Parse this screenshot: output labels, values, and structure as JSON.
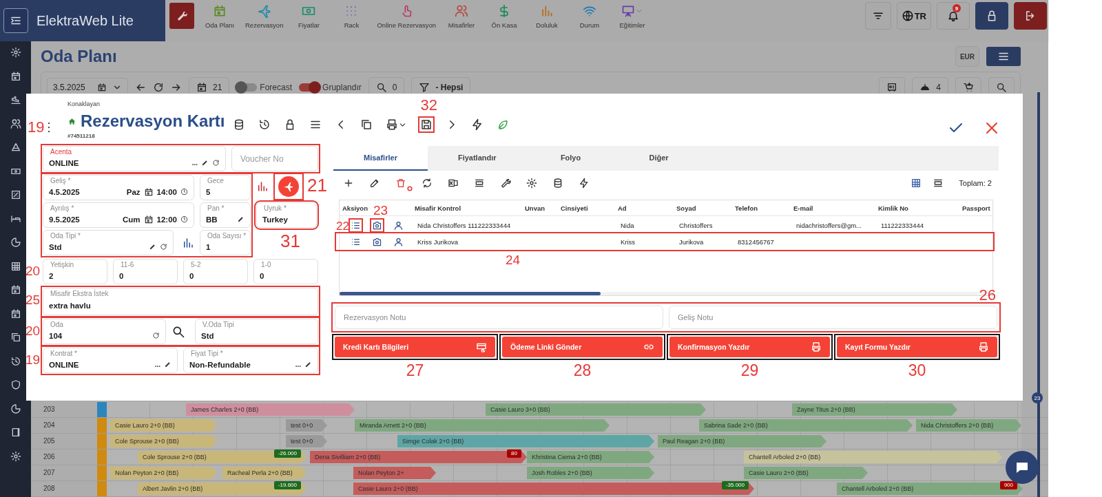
{
  "app": {
    "brand": "ElektraWeb Lite"
  },
  "nav": [
    {
      "label": "Oda Planı"
    },
    {
      "label": "Rezervasyon"
    },
    {
      "label": "Fiyatlar"
    },
    {
      "label": "Rack"
    },
    {
      "label": "Online Rezervasyon"
    },
    {
      "label": "Misafirler"
    },
    {
      "label": "Ön Kasa"
    },
    {
      "label": "Doluluk"
    },
    {
      "label": "Durum"
    },
    {
      "label": "Eğitimler"
    }
  ],
  "topbar_right": {
    "language": "TR",
    "notifications": "9"
  },
  "page": {
    "title": "Oda Planı",
    "currency": "EUR"
  },
  "toolbar": {
    "date": "3.5.2025",
    "days": "21",
    "forecast": {
      "label": "Forecast",
      "on": false
    },
    "grouping": {
      "label": "Gruplandır",
      "on": true
    },
    "search_count": "0",
    "filter": "- Hepsi",
    "room_service_count": "4"
  },
  "room_grid": {
    "badge": "23",
    "rows": [
      {
        "room": "203",
        "color": "#2a86bd",
        "bookings": [
          {
            "label": "James Charles 2+0 (BB)",
            "color": "#cf8e9e"
          },
          {
            "label": "Casie Lauro 3+0 (BB)",
            "color": "#80a880"
          },
          {
            "label": "Zayne Titus 2+0 (BB)",
            "color": "#80a880"
          }
        ]
      },
      {
        "room": "204",
        "color": "#cf8a10",
        "bookings": [
          {
            "label": "Casie Lauro 2+0 (BB)",
            "color": "#c9b77a"
          },
          {
            "label": "test 0+0",
            "color": "#9a9a9a"
          },
          {
            "label": "Miranda Arnett 2+0 (BB)",
            "color": "#80a880"
          },
          {
            "label": "Sabrina Sade 2+0 (BB)",
            "color": "#80a880"
          },
          {
            "label": "Nida Christoffers 2+0 (BB)",
            "color": "#80a880"
          }
        ]
      },
      {
        "room": "205",
        "color": "#cf8a10",
        "bookings": [
          {
            "label": "Cole Sprouse 2+0 (BB)",
            "color": "#c9b77a"
          },
          {
            "label": "test 0+0",
            "color": "#9a9a9a"
          },
          {
            "label": "Simge Colak 2+0 (BB)",
            "color": "#5ea6a6"
          },
          {
            "label": "Paul Reagan 2+0 (BB)",
            "color": "#80a880"
          }
        ]
      },
      {
        "room": "206",
        "color": "#cf8a10",
        "bookings": [
          {
            "label": "Cole Sprouse 2+0 (BB)",
            "color": "#c9b77a",
            "badge": {
              "text": "-26.000",
              "color": "#1e6b1e"
            }
          },
          {
            "label": "Dena Sivilliam 2+0 (BB)",
            "color": "#c45c5c",
            "badge": {
              "text": "80",
              "color": "#a80000"
            }
          },
          {
            "label": "Khristina Ciema 2+0 (BB)",
            "color": "#80a880"
          },
          {
            "label": "Chantell Arboled 2+0 (BB)",
            "color": "#c6c39c"
          }
        ]
      },
      {
        "room": "207",
        "color": "#cf8a10",
        "bookings": [
          {
            "label": "Nolan Peyton 2+0 (BB)",
            "color": "#c9b77a"
          },
          {
            "label": "Racheal Perla 2+0 (BB)",
            "color": "#c9b77a"
          },
          {
            "label": "Nolan Peyton 2+",
            "color": "#c45c5c"
          },
          {
            "label": "Josh Robles 2+0 (BB)",
            "color": "#80a880"
          },
          {
            "label": "Casie Lauro 2+0 (BB)",
            "color": "#80a880"
          }
        ]
      },
      {
        "room": "208",
        "color": "#cf8a10",
        "bookings": [
          {
            "label": "Albert Javlin 2+0 (BB)",
            "color": "#c9b77a",
            "badge": {
              "text": "-19.600",
              "color": "#1e6b1e"
            }
          },
          {
            "label": "Casie Lauro 2+0 (BB)",
            "color": "#c45c5c",
            "badge": {
              "text": "-35.000",
              "color": "#1e6b1e"
            }
          },
          {
            "label": "Chantell Arboled 2+0 (BB)",
            "color": "#80a880",
            "badge": {
              "text": "900",
              "color": "#a80000"
            }
          }
        ]
      }
    ]
  },
  "reservation_card": {
    "subtitle": "Konaklayan",
    "title": "Rezervasyon Kartı",
    "number": "#74511218",
    "save_callout": "32",
    "agency": {
      "label": "Acenta",
      "value": "ONLINE",
      "more": "...",
      "invalid": true,
      "callout": "19"
    },
    "voucher": {
      "placeholder": "Voucher No"
    },
    "arrival": {
      "label": "Geliş *",
      "date": "4.5.2025",
      "weekday": "Paz",
      "time": "14:00"
    },
    "nights": {
      "label": "Gece",
      "value": "5"
    },
    "departure": {
      "label": "Ayrılış *",
      "date": "9.5.2025",
      "weekday": "Cum",
      "time": "12:00"
    },
    "board": {
      "label": "Pan *",
      "value": "BB"
    },
    "room_type": {
      "label": "Oda Tipi *",
      "value": "Std"
    },
    "room_count": {
      "label": "Oda Sayısı *",
      "value": "1"
    },
    "flight_callout": "21",
    "nationality": {
      "label": "Uyruk *",
      "value": "Turkey",
      "callout": "31"
    },
    "guests": {
      "callout": "20",
      "fields": [
        {
          "label": "Yetişkin",
          "value": "2"
        },
        {
          "label": "11-6",
          "value": "0"
        },
        {
          "label": "5-2",
          "value": "0"
        },
        {
          "label": "1-0",
          "value": "0"
        }
      ]
    },
    "extra_request": {
      "label": "Misafir Ekstra İstek",
      "value": "extra havlu",
      "callout": "25"
    },
    "room": {
      "label": "Oda",
      "value": "104"
    },
    "virtual_room_type": {
      "label": "V.Oda Tipi",
      "value": "Std"
    },
    "room_callout": "20",
    "contract": {
      "label": "Kontrat *",
      "value": "ONLINE",
      "more": "..."
    },
    "rate_type": {
      "label": "Fiyat Tipi *",
      "value": "Non-Refundable",
      "more": "..."
    },
    "contract_callout": "19",
    "tabs": [
      {
        "label": "Misafirler",
        "selected": true
      },
      {
        "label": "Fiyatlandır",
        "selected": false
      },
      {
        "label": "Folyo",
        "selected": false
      },
      {
        "label": "Diğer",
        "selected": false
      }
    ],
    "total": "Toplam: 2",
    "guest_table": {
      "columns": [
        "Aksiyon",
        "Misafir Kontrol",
        "Unvan",
        "Cinsiyeti",
        "Ad",
        "Soyad",
        "Telefon",
        "E-mail",
        "Kimlik No",
        "Passport"
      ],
      "rows": [
        {
          "cells": [
            "",
            "Nida Christoffers 111222333444",
            "",
            "",
            "Nida",
            "Christoffers",
            "",
            "nidachristoffers@gm...",
            "111222333444",
            ""
          ],
          "list_callout": "22",
          "camera_callout": "23"
        },
        {
          "cells": [
            "",
            "Kriss Jurikova",
            "",
            "",
            "Kriss",
            "Jurikova",
            "8312456767",
            "",
            "",
            ""
          ],
          "callout": "24"
        }
      ]
    },
    "notes": {
      "callout": "26",
      "fields": [
        {
          "placeholder": "Rezervasyon Notu"
        },
        {
          "placeholder": "Geliş Notu"
        }
      ]
    },
    "actions": [
      {
        "label": "Kredi Kartı Bilgileri",
        "kind": "card",
        "callout": "27"
      },
      {
        "label": "Ödeme Linki Gönder",
        "kind": "link",
        "callout": "28"
      },
      {
        "label": "Konfirmasyon Yazdır",
        "kind": "print",
        "callout": "29"
      },
      {
        "label": "Kayıt Formu Yazdır",
        "kind": "print",
        "callout": "30"
      }
    ]
  }
}
